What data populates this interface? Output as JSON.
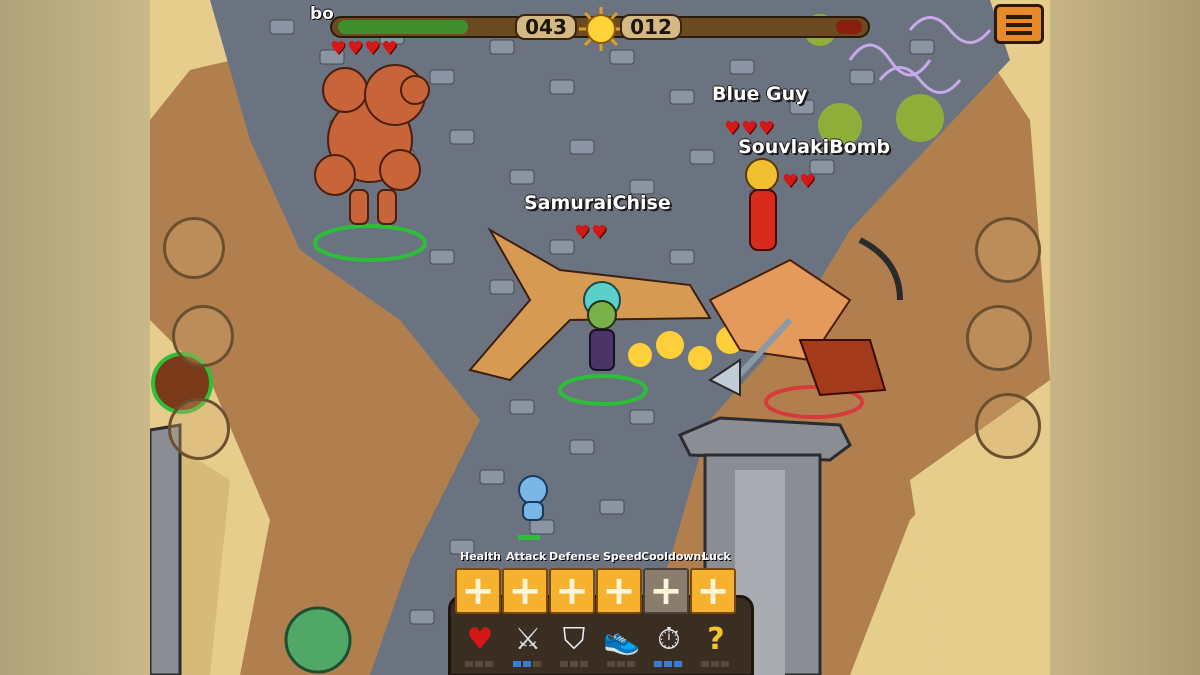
{
  "hud": {
    "top_player_name": "bo",
    "left_score": "043",
    "right_score": "012",
    "left_fill_fraction": 0.25,
    "right_fill_fraction": 0.05,
    "menu_icon": "menu-icon"
  },
  "players": [
    {
      "name": "Blue Guy",
      "hearts": "♥♥♥"
    },
    {
      "name": "SouvlakiBomb",
      "hearts": "♥♥"
    },
    {
      "name": "SamuraiChise",
      "hearts": "♥♥"
    }
  ],
  "top_player_hearts": "♥♥♥♥",
  "stats": {
    "labels": [
      "Health",
      "Attack",
      "Defense",
      "Speed",
      "Cooldowns",
      "Luck"
    ],
    "plus_symbol": "+",
    "icons": [
      "heart-icon",
      "sword-icon",
      "shield-icon",
      "boot-icon",
      "stopwatch-icon",
      "mystery-gift-icon"
    ],
    "icon_glyphs": [
      "♥",
      "⚔",
      "⛉",
      "👟",
      "⏱",
      "?"
    ],
    "levels": [
      0,
      2,
      0,
      0,
      3,
      0
    ],
    "max_level": 3,
    "disabled_index": 4
  },
  "colors": {
    "upgrade": "#f6b22e",
    "health_green": "#3f8f2e",
    "enemy_red": "#8a1f10"
  }
}
